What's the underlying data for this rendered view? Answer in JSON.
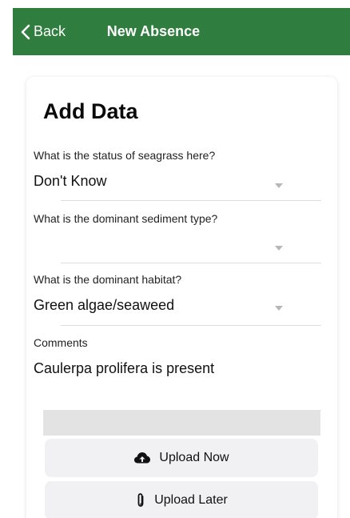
{
  "nav": {
    "back_label": "Back",
    "title": "New Absence"
  },
  "card": {
    "title": "Add Data"
  },
  "fields": [
    {
      "label": "What is the status of seagrass here?",
      "value": "Don't Know",
      "type": "select"
    },
    {
      "label": "What is the dominant sediment type?",
      "value": "",
      "type": "select"
    },
    {
      "label": "What is the dominant habitat?",
      "value": "Green algae/seaweed",
      "type": "select"
    },
    {
      "label": "Comments",
      "value": "Caulerpa prolifera is present",
      "type": "text"
    }
  ],
  "actions": {
    "upload_now_label": "Upload Now",
    "upload_later_label": "Upload Later"
  },
  "colors": {
    "nav_background": "#2f7d3f",
    "button_background": "#f1f1f4",
    "separator": "#dedede"
  },
  "icons": {
    "back": "chevron-left-icon",
    "upload_now": "cloud-upload-icon",
    "upload_later": "paperclip-icon",
    "dropdown": "caret-down-icon"
  }
}
